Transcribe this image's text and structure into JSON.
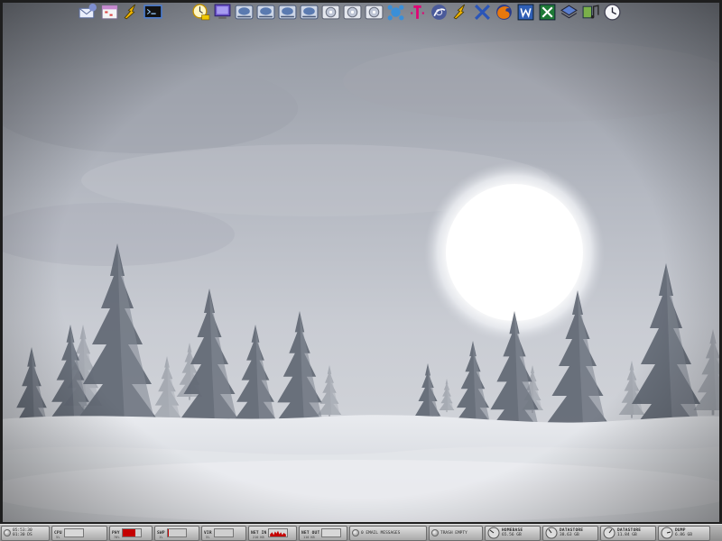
{
  "dock": {
    "icons": [
      "mail-icon",
      "calendar-icon",
      "winamp-icon",
      "terminal-icon",
      "clock-icon",
      "monitor-icon",
      "drive-1-icon",
      "drive-2-icon",
      "drive-3-icon",
      "drive-4-icon",
      "cd-1-icon",
      "cd-2-icon",
      "cd-3-icon",
      "network-icon",
      "tmobile-icon",
      "browser-icon",
      "winamp-2-icon",
      "x-icon",
      "firefox-icon",
      "word-icon",
      "excel-icon",
      "layers-icon",
      "music-icon",
      "system-clock-icon"
    ]
  },
  "statusbar": {
    "clock": {
      "time": "05:53:30",
      "date": "01:30 DS"
    },
    "cpu": {
      "label": "CPU",
      "value": "5%"
    },
    "phy": {
      "label": "PHY",
      "value": "70%",
      "fill": 0.7
    },
    "swp": {
      "label": "SWP",
      "value": "1%",
      "fill": 0.05
    },
    "vir": {
      "label": "VIR",
      "value": "5%"
    },
    "net_in": {
      "label": "NET IN",
      "value": "210 KB"
    },
    "net_out": {
      "label": "NET OUT",
      "value": "110 KB"
    },
    "email": {
      "text": "0 EMAIL MESSAGES"
    },
    "trash": {
      "text": "TRASH EMPTY"
    },
    "drives": [
      {
        "name": "HOMEBASE",
        "size": "65.56 GB"
      },
      {
        "name": "DATASTORE",
        "size": "38.63 GB"
      },
      {
        "name": "DATASTORE",
        "size": "11.84 GB"
      },
      {
        "name": "DUMP",
        "size": "6.86 GB"
      }
    ]
  },
  "colors": {
    "accent_red": "#c40000",
    "sky": "#b9bdc6",
    "snow": "#e3e5ea"
  }
}
